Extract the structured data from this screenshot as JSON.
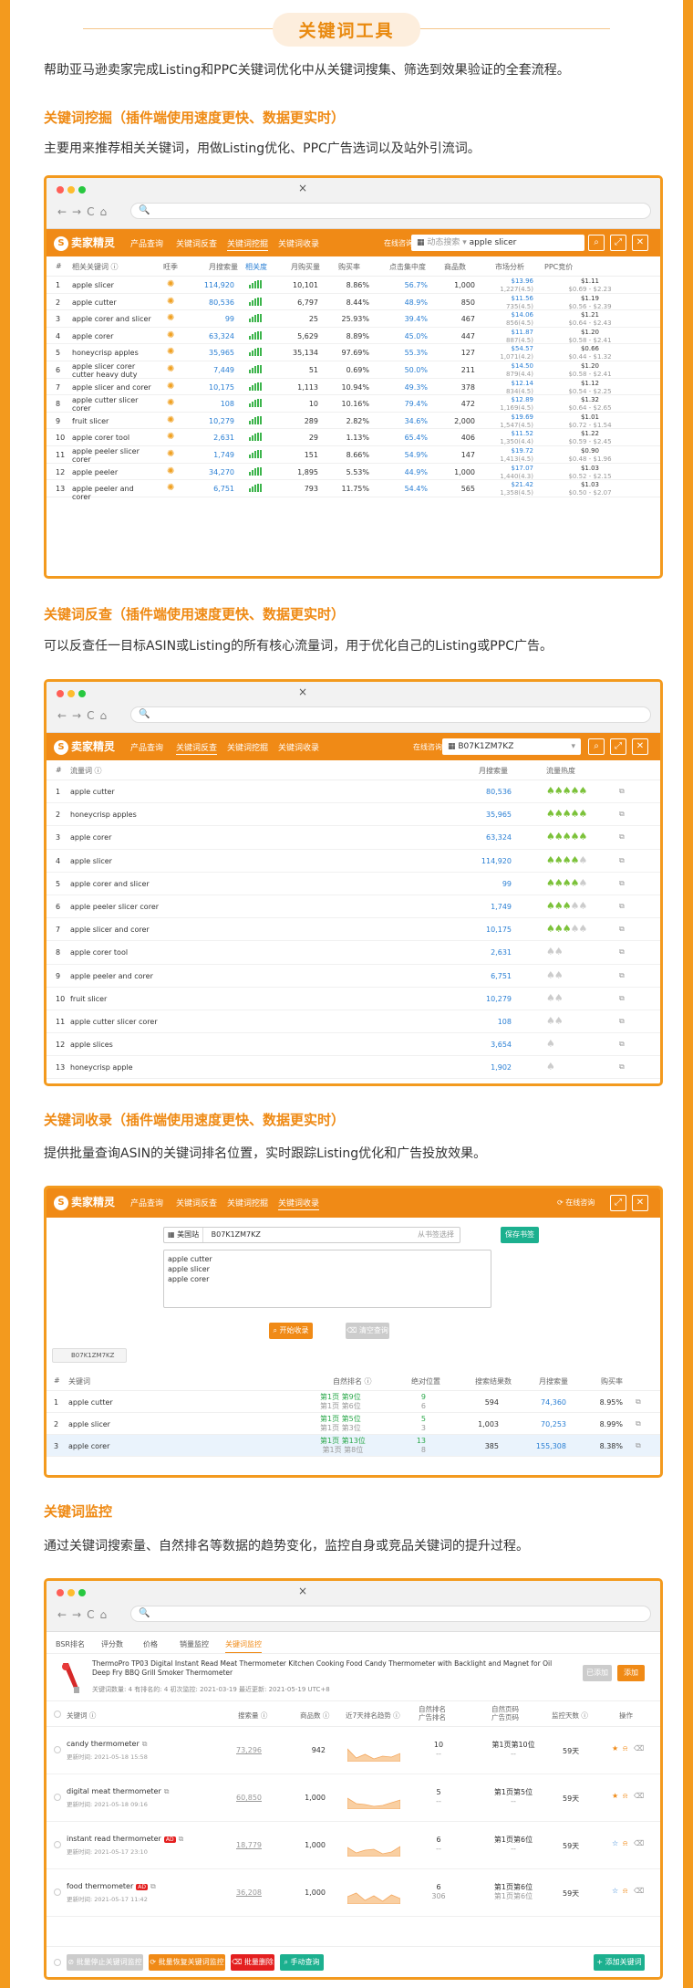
{
  "page_title": "关键词工具",
  "intro": "帮助亚马逊卖家完成Listing和PPC关键词优化中从关键词搜集、筛选到效果验证的全套流程。",
  "s1": {
    "heading": "关键词挖掘（插件端使用速度更快、数据更实时）",
    "desc": "主要用来推荐相关关键词，用做Listing优化、PPC广告选词以及站外引流词。"
  },
  "s2": {
    "heading": "关键词反查（插件端使用速度更快、数据更实时）",
    "desc": "可以反查任一目标ASIN或Listing的所有核心流量词，用于优化自己的Listing或PPC广告。"
  },
  "s3": {
    "heading": "关键词收录（插件端使用速度更快、数据更实时）",
    "desc": "提供批量查询ASIN的关键词排名位置，实时跟踪Listing优化和广告投放效果。"
  },
  "s4": {
    "heading": "关键词监控",
    "desc": "通过关键词搜索量、自然排名等数据的趋势变化，监控自身或竞品关键词的提升过程。"
  },
  "browser": {
    "close": "×",
    "nav": "←→C⌂",
    "search_icon": "🔍"
  },
  "brand": {
    "logo": "卖家精灵",
    "logo_char": "S"
  },
  "m1": {
    "nav": [
      "产品查询",
      "关键词反查",
      "关键词挖掘",
      "关键词收录"
    ],
    "search_label": "在线咨询",
    "market": "动态搜索",
    "query": "apple slicer",
    "headers": [
      "#",
      "相关关键词 ⓘ",
      "旺季",
      "月搜索量",
      "相关度",
      "月购买量",
      "购买率",
      "点击集中度",
      "商品数",
      "市场分析",
      "PPC竞价"
    ],
    "rows": [
      {
        "n": "1",
        "kw": "apple slicer",
        "sv": "114,920",
        "buy": "10,101",
        "rate": "8.86%",
        "click": "56.7%",
        "prod": "1,000",
        "price": "$13.96",
        "rev": "1,227(4.5)",
        "ppc": "$1.11",
        "ppc_r": "$0.69 - $2.23"
      },
      {
        "n": "2",
        "kw": "apple cutter",
        "sv": "80,536",
        "buy": "6,797",
        "rate": "8.44%",
        "click": "48.9%",
        "prod": "850",
        "price": "$11.56",
        "rev": "735(4.5)",
        "ppc": "$1.19",
        "ppc_r": "$0.56 - $2.39"
      },
      {
        "n": "3",
        "kw": "apple corer and slicer",
        "sv": "99",
        "buy": "25",
        "rate": "25.93%",
        "click": "39.4%",
        "prod": "467",
        "price": "$14.06",
        "rev": "856(4.5)",
        "ppc": "$1.21",
        "ppc_r": "$0.64 - $2.43"
      },
      {
        "n": "4",
        "kw": "apple corer",
        "sv": "63,324",
        "buy": "5,629",
        "rate": "8.89%",
        "click": "45.0%",
        "prod": "447",
        "price": "$11.87",
        "rev": "887(4.5)",
        "ppc": "$1.20",
        "ppc_r": "$0.58 - $2.41"
      },
      {
        "n": "5",
        "kw": "honeycrisp apples",
        "sv": "35,965",
        "buy": "35,134",
        "rate": "97.69%",
        "click": "55.3%",
        "prod": "127",
        "price": "$54.57",
        "rev": "1,071(4.2)",
        "ppc": "$0.66",
        "ppc_r": "$0.44 - $1.32"
      },
      {
        "n": "6",
        "kw": "apple slicer corer cutter heavy duty",
        "sv": "7,449",
        "buy": "51",
        "rate": "0.69%",
        "click": "50.0%",
        "prod": "211",
        "price": "$14.50",
        "rev": "879(4.4)",
        "ppc": "$1.20",
        "ppc_r": "$0.58 - $2.41"
      },
      {
        "n": "7",
        "kw": "apple slicer and corer",
        "sv": "10,175",
        "buy": "1,113",
        "rate": "10.94%",
        "click": "49.3%",
        "prod": "378",
        "price": "$12.14",
        "rev": "834(4.5)",
        "ppc": "$1.12",
        "ppc_r": "$0.54 - $2.25"
      },
      {
        "n": "8",
        "kw": "apple cutter slicer corer",
        "sv": "108",
        "buy": "10",
        "rate": "10.16%",
        "click": "79.4%",
        "prod": "472",
        "price": "$12.89",
        "rev": "1,169(4.5)",
        "ppc": "$1.32",
        "ppc_r": "$0.64 - $2.65"
      },
      {
        "n": "9",
        "kw": "fruit slicer",
        "sv": "10,279",
        "buy": "289",
        "rate": "2.82%",
        "click": "34.6%",
        "prod": "2,000",
        "price": "$19.69",
        "rev": "1,547(4.5)",
        "ppc": "$1.01",
        "ppc_r": "$0.72 - $1.54"
      },
      {
        "n": "10",
        "kw": "apple corer tool",
        "sv": "2,631",
        "buy": "29",
        "rate": "1.13%",
        "click": "65.4%",
        "prod": "406",
        "price": "$11.52",
        "rev": "1,350(4.4)",
        "ppc": "$1.22",
        "ppc_r": "$0.59 - $2.45"
      },
      {
        "n": "11",
        "kw": "apple peeler slicer corer",
        "sv": "1,749",
        "buy": "151",
        "rate": "8.66%",
        "click": "54.9%",
        "prod": "147",
        "price": "$19.72",
        "rev": "1,413(4.5)",
        "ppc": "$0.90",
        "ppc_r": "$0.48 - $1.96"
      },
      {
        "n": "12",
        "kw": "apple peeler",
        "sv": "34,270",
        "buy": "1,895",
        "rate": "5.53%",
        "click": "44.9%",
        "prod": "1,000",
        "price": "$17.07",
        "rev": "1,440(4.3)",
        "ppc": "$1.03",
        "ppc_r": "$0.52 - $2.15"
      },
      {
        "n": "13",
        "kw": "apple peeler and corer",
        "sv": "6,751",
        "buy": "793",
        "rate": "11.75%",
        "click": "54.4%",
        "prod": "565",
        "price": "$21.42",
        "rev": "1,358(4.5)",
        "ppc": "$1.03",
        "ppc_r": "$0.50 - $2.07"
      }
    ]
  },
  "m2": {
    "nav": [
      "产品查询",
      "关键词反查",
      "关键词挖掘",
      "关键词收录"
    ],
    "search_label": "在线咨询",
    "asin": "B07K1ZM7KZ",
    "headers": [
      "#",
      "流量词 ⓘ",
      "月搜索量",
      "流量热度"
    ],
    "rows": [
      {
        "n": "1",
        "kw": "apple cutter",
        "sv": "80,536",
        "heat": 5
      },
      {
        "n": "2",
        "kw": "honeycrisp apples",
        "sv": "35,965",
        "heat": 5
      },
      {
        "n": "3",
        "kw": "apple corer",
        "sv": "63,324",
        "heat": 5
      },
      {
        "n": "4",
        "kw": "apple slicer",
        "sv": "114,920",
        "heat": 4
      },
      {
        "n": "5",
        "kw": "apple corer and slicer",
        "sv": "99",
        "heat": 4
      },
      {
        "n": "6",
        "kw": "apple peeler slicer corer",
        "sv": "1,749",
        "heat": 3
      },
      {
        "n": "7",
        "kw": "apple slicer and corer",
        "sv": "10,175",
        "heat": 3
      },
      {
        "n": "8",
        "kw": "apple corer tool",
        "sv": "2,631",
        "heat": 0
      },
      {
        "n": "9",
        "kw": "apple peeler and corer",
        "sv": "6,751",
        "heat": 0
      },
      {
        "n": "10",
        "kw": "fruit slicer",
        "sv": "10,279",
        "heat": 0
      },
      {
        "n": "11",
        "kw": "apple cutter slicer corer",
        "sv": "108",
        "heat": 0
      },
      {
        "n": "12",
        "kw": "apple slices",
        "sv": "3,654",
        "heat": 0
      },
      {
        "n": "13",
        "kw": "honeycrisp apple",
        "sv": "1,902",
        "heat": 0
      }
    ]
  },
  "m3": {
    "nav": [
      "产品查询",
      "关键词反查",
      "关键词挖掘",
      "关键词收录"
    ],
    "consult": "⟳ 在线咨询",
    "market": "美国站",
    "asin": "B07K1ZM7KZ",
    "hint": "从书签选择",
    "save": "保存书签",
    "keywords": [
      "apple cutter",
      "apple slicer",
      "apple corer"
    ],
    "start": "开始收录",
    "clear": "清空查询",
    "tag": "B07K1ZM7KZ",
    "headers": [
      "#",
      "关键词",
      "自然排名 ⓘ",
      "绝对位置",
      "搜索结果数",
      "月搜索量",
      "购买率"
    ],
    "rows": [
      {
        "n": "1",
        "kw": "apple cutter",
        "rank1": "第1页 第9位",
        "rank2": "第1页 第6位",
        "pos1": "9",
        "pos2": "6",
        "results": "594",
        "sv": "74,360",
        "rate": "8.95%"
      },
      {
        "n": "2",
        "kw": "apple slicer",
        "rank1": "第1页 第5位",
        "rank2": "第1页 第3位",
        "pos1": "5",
        "pos2": "3",
        "results": "1,003",
        "sv": "70,253",
        "rate": "8.99%"
      },
      {
        "n": "3",
        "kw": "apple corer",
        "rank1": "第1页 第13位",
        "rank2": "第1页 第8位",
        "pos1": "13",
        "pos2": "8",
        "results": "385",
        "sv": "155,308",
        "rate": "8.38%"
      }
    ]
  },
  "m4": {
    "tabs": [
      "BSR排名",
      "评分数",
      "价格",
      "销量监控",
      "关键词监控"
    ],
    "product_title": "ThermoPro TP03 Digital Instant Read Meat Thermometer Kitchen Cooking Food Candy Thermometer with Backlight and Magnet for Oil Deep Fry BBQ Grill Smoker Thermometer",
    "meta": "关键词数量: 4    有排名的: 4    初次监控: 2021-03-19    最近更新: 2021-05-19 UTC+8",
    "btn_a": "已添加",
    "btn_b": "添加",
    "headers": [
      "关键词 ⓘ",
      "搜索量 ⓘ",
      "商品数 ⓘ",
      "近7天排名趋势 ⓘ",
      "自然排名\n广告排名",
      "自然页码\n广告页码",
      "监控天数 ⓘ",
      "操作"
    ],
    "rows": [
      {
        "kw": "candy thermometer",
        "upd": "更新时间: 2021-05-18 15:58",
        "sv": "73,296",
        "prod": "942",
        "rank": "10",
        "rank2": "--",
        "page": "第1页第10位",
        "page2": "--",
        "days": "59天",
        "ad": ""
      },
      {
        "kw": "digital meat thermometer",
        "upd": "更新时间: 2021-05-18 09:16",
        "sv": "60,850",
        "prod": "1,000",
        "rank": "5",
        "rank2": "--",
        "page": "第1页第5位",
        "page2": "--",
        "days": "59天",
        "ad": ""
      },
      {
        "kw": "instant read thermometer",
        "upd": "更新时间: 2021-05-17 23:10",
        "sv": "18,779",
        "prod": "1,000",
        "rank": "6",
        "rank2": "--",
        "page": "第1页第6位",
        "page2": "--",
        "days": "59天",
        "ad": "AD"
      },
      {
        "kw": "food thermometer",
        "upd": "更新时间: 2021-05-17 11:42",
        "sv": "36,208",
        "prod": "1,000",
        "rank": "6",
        "rank2": "306",
        "page": "第1页第6位",
        "page2": "第1页第6位",
        "days": "59天",
        "ad": "AD"
      }
    ],
    "footer": [
      "批量停止关键词监控",
      "批量恢复关键词监控",
      "批量删除",
      "手动查询"
    ],
    "add": "+ 添加关键词"
  },
  "colors": {
    "orange": "#f08a16",
    "blue": "#2a7fd4",
    "green": "#3cb44b"
  }
}
